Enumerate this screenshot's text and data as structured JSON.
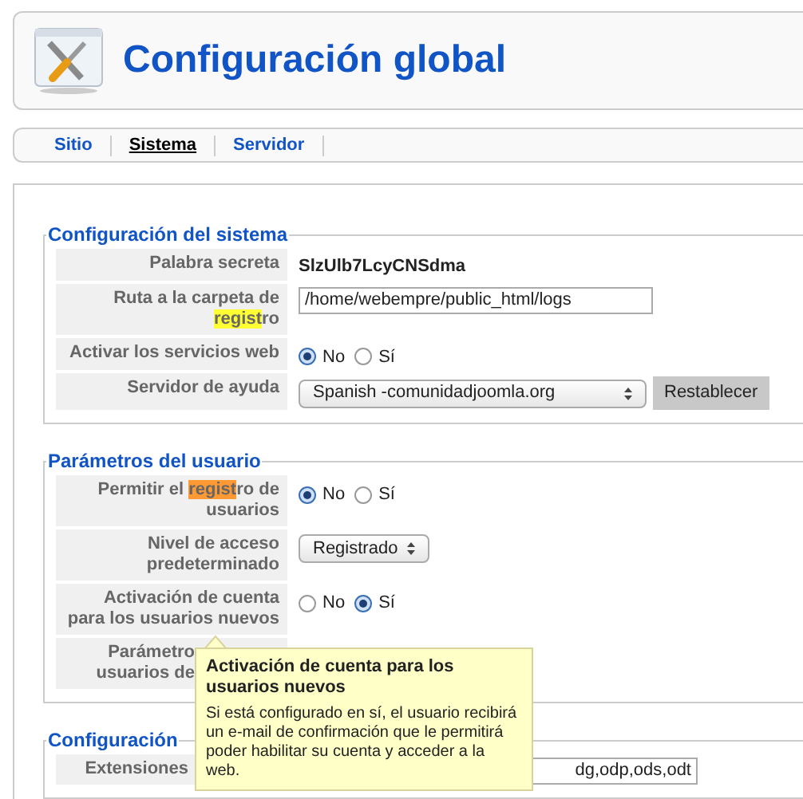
{
  "header": {
    "title": "Configuración global"
  },
  "tabs": [
    {
      "label": "Sitio",
      "selected": false
    },
    {
      "label": "Sistema",
      "selected": true
    },
    {
      "label": "Servidor",
      "selected": false
    }
  ],
  "sections": [
    {
      "title": "Configuración del sistema",
      "rows": [
        {
          "kind": "text",
          "label": "Palabra secreta",
          "value": "SlzUlb7LcyCNSdma"
        },
        {
          "kind": "input",
          "label": "Ruta a la carpeta de ",
          "highlight": "regist",
          "label_after": "ro",
          "color": "#ffff33",
          "value": "/home/webempre/public_html/logs"
        },
        {
          "kind": "radio",
          "label": "Activar los servicios web",
          "options": [
            {
              "label": "No",
              "selected": true
            },
            {
              "label": "Sí",
              "selected": false
            }
          ]
        },
        {
          "kind": "select",
          "label": "Servidor de ayuda",
          "value": "Spanish -comunidadjoomla.org",
          "button": "Restablecer"
        }
      ]
    },
    {
      "title": "Parámetros del usuario",
      "rows": [
        {
          "kind": "radio",
          "label": "Permitir el ",
          "highlight": "regist",
          "label_after": "ro de usuarios",
          "color": "#ff9933",
          "options": [
            {
              "label": "No",
              "selected": true
            },
            {
              "label": "Sí",
              "selected": false
            }
          ]
        },
        {
          "kind": "small-select",
          "label": "Nivel de acceso predeterminado",
          "value": "Registrado"
        },
        {
          "kind": "radio",
          "label": "Activación de cuenta para los usuarios nuevos",
          "options": [
            {
              "label": "No",
              "selected": false
            },
            {
              "label": "Sí",
              "selected": true
            }
          ]
        },
        {
          "kind": "blank",
          "label_lines": [
            "Parámetro",
            "usuarios de"
          ]
        }
      ]
    },
    {
      "title": "Configuración",
      "rows": [
        {
          "kind": "input",
          "label": "Extensiones",
          "value": "dg,odp,ods,odt"
        }
      ]
    }
  ],
  "tooltip": {
    "title": "Activación de cuenta para los usuarios nuevos",
    "text": "Si está configurado en sí, el usuario recibirá un e-mail de confirmación que le permitirá poder habilitar su cuenta y acceder a la web."
  }
}
